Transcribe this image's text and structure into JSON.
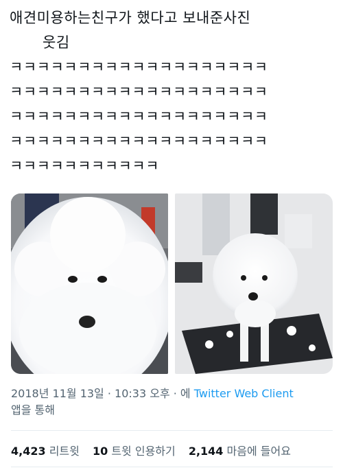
{
  "tweet": {
    "lines": [
      "애견미용하는친구가 했다고 보내준사진",
      "웃김",
      "ㅋㅋㅋㅋㅋㅋㅋㅋㅋㅋㅋㅋㅋㅋㅋㅋㅋㅋㅋ",
      "ㅋㅋㅋㅋㅋㅋㅋㅋㅋㅋㅋㅋㅋㅋㅋㅋㅋㅋㅋ",
      "ㅋㅋㅋㅋㅋㅋㅋㅋㅋㅋㅋㅋㅋㅋㅋㅋㅋㅋㅋ",
      "ㅋㅋㅋㅋㅋㅋㅋㅋㅋㅋㅋㅋㅋㅋㅋㅋㅋㅋㅋ",
      "ㅋㅋㅋㅋㅋㅋㅋㅋㅋㅋㅋ"
    ]
  },
  "meta": {
    "timestamp": "2018년 11월 13일 · 10:33 오후 · 에",
    "source": "Twitter Web Client",
    "via_suffix": "앱을 통해"
  },
  "stats": {
    "retweets_count": "4,423",
    "retweets_label": "리트윗",
    "quotes_count": "10",
    "quotes_label": "트윗 인용하기",
    "likes_count": "2,144",
    "likes_label": "마음에 들어요"
  },
  "colors": {
    "text": "#0f1419",
    "secondary": "#536471",
    "link": "#1d9bf0",
    "divider": "#e6ecf0"
  }
}
